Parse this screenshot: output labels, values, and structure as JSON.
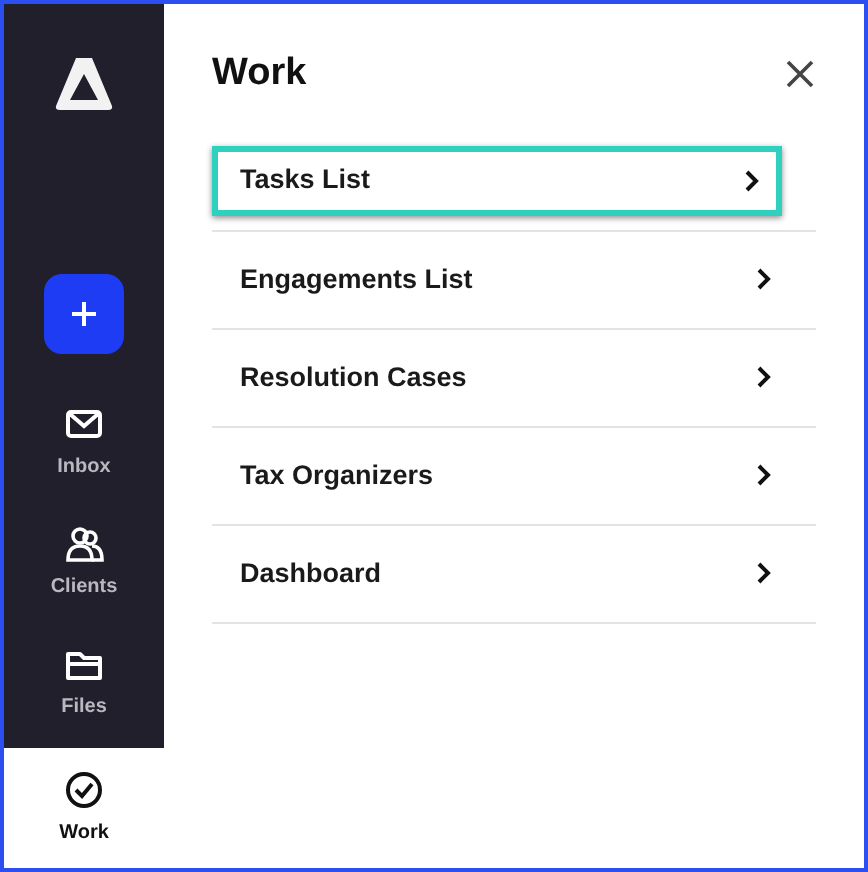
{
  "sidebar": {
    "items": [
      {
        "label": "Inbox",
        "kind": "inbox",
        "selected": false
      },
      {
        "label": "Clients",
        "kind": "clients",
        "selected": false
      },
      {
        "label": "Files",
        "kind": "files",
        "selected": false
      },
      {
        "label": "Work",
        "kind": "work",
        "selected": true
      }
    ]
  },
  "panel": {
    "title": "Work",
    "items": [
      {
        "label": "Tasks List",
        "highlighted": true
      },
      {
        "label": "Engagements List",
        "highlighted": false
      },
      {
        "label": "Resolution Cases",
        "highlighted": false
      },
      {
        "label": "Tax Organizers",
        "highlighted": false
      },
      {
        "label": "Dashboard",
        "highlighted": false
      }
    ]
  }
}
